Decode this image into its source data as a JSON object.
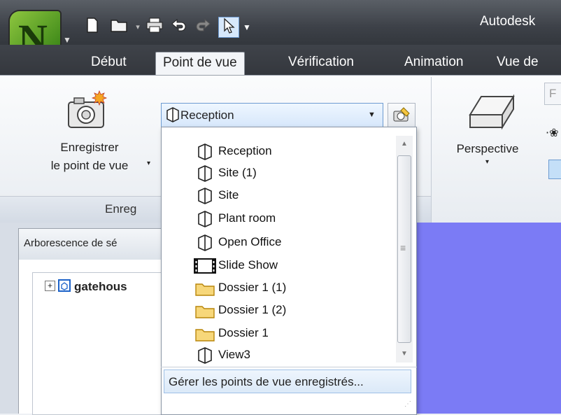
{
  "title_bar": {
    "app_title": "Autodesk",
    "quick_access": [
      "new-icon",
      "open-icon",
      "dropdown-icon",
      "print-icon",
      "undo-icon",
      "redo-icon",
      "select-icon",
      "customize-icon"
    ]
  },
  "tabs": [
    {
      "label": "Début",
      "active": false
    },
    {
      "label": "Point de vue",
      "active": true
    },
    {
      "label": "Vérification",
      "active": false
    },
    {
      "label": "Animation",
      "active": false
    },
    {
      "label": "Vue de",
      "active": false
    }
  ],
  "ribbon": {
    "save_viewpoint_line1": "Enregistrer",
    "save_viewpoint_line2": "le point de vue",
    "panel_title": "Enreg",
    "perspective_label": "Perspective",
    "right_button_label": "F"
  },
  "combo": {
    "selected": "Reception"
  },
  "dropdown": {
    "items": [
      {
        "label": "Reception",
        "icon": "viewpoint-icon"
      },
      {
        "label": "Site (1)",
        "icon": "viewpoint-icon"
      },
      {
        "label": "Site",
        "icon": "viewpoint-icon"
      },
      {
        "label": "Plant room",
        "icon": "viewpoint-icon"
      },
      {
        "label": "Open Office",
        "icon": "viewpoint-icon"
      },
      {
        "label": "Slide Show",
        "icon": "film-icon"
      },
      {
        "label": "Dossier 1 (1)",
        "icon": "folder-icon"
      },
      {
        "label": "Dossier 1 (2)",
        "icon": "folder-icon"
      },
      {
        "label": "Dossier 1",
        "icon": "folder-icon"
      },
      {
        "label": "View3",
        "icon": "viewpoint-icon"
      }
    ],
    "manage_label": "Gérer les points de vue enregistrés..."
  },
  "tree": {
    "header": "Arborescence de sé",
    "root_label": "gatehous"
  },
  "colors": {
    "viewport": "#7b7bf5",
    "accent": "#6d9bd1"
  }
}
